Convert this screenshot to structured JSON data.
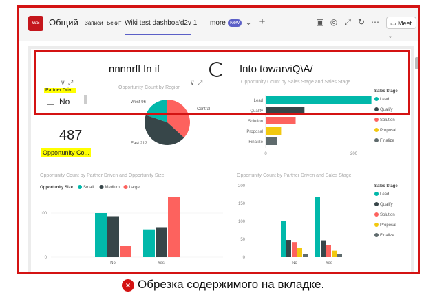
{
  "teams": {
    "app_icon_text": "WS",
    "channel_name": "Общий",
    "tabs": [
      "Записи",
      "Бекит",
      "Wiki test dashboa'd2v 1"
    ],
    "more_label": "more",
    "new_badge": "New",
    "meet_label": "Meet"
  },
  "glitch_text": {
    "left": "nnnnrfl In if",
    "right": "Into towarviQ\\A/"
  },
  "slicer": {
    "title": "Partner Driv...",
    "option_label": "No"
  },
  "card": {
    "value": "487",
    "label": "Opportunity Co..."
  },
  "pie_chart": {
    "title": "Opportunity Count by Region",
    "labels": [
      "West 96",
      "Central",
      "East 212"
    ],
    "colors": [
      "#01b8aa",
      "#fd625e",
      "#374649"
    ]
  },
  "bar_chart": {
    "title": "Opportunity Count by Sales Stage and Sales Stage",
    "legend_title": "Sales Stage",
    "colors": [
      "#01b8aa",
      "#374649",
      "#fd625e",
      "#f2c80f",
      "#5f6b6d"
    ]
  },
  "col_chart_left": {
    "title": "Opportunity Count by Partner Driven and Opportunity Size",
    "legend_title": "Opportunity Size",
    "colors": [
      "#01b8aa",
      "#374649",
      "#fd625e"
    ]
  },
  "col_chart_right": {
    "title": "Opportunity Count by Partner Driven and Sales Stage",
    "legend_title": "Sales Stage",
    "colors": [
      "#01b8aa",
      "#374649",
      "#fd625e",
      "#f2c80f",
      "#5f6b6d"
    ]
  },
  "chart_data": [
    {
      "type": "pie",
      "title": "Opportunity Count by Region",
      "categories": [
        "West",
        "Central",
        "East"
      ],
      "values": [
        96,
        179,
        212
      ]
    },
    {
      "type": "bar",
      "title": "Opportunity Count by Sales Stage and Sales Stage",
      "categories": [
        "Lead",
        "Qualify",
        "Solution",
        "Proposal",
        "Finalize"
      ],
      "values": [
        240,
        88,
        68,
        35,
        25
      ],
      "xlim": [
        0,
        250
      ],
      "x_ticks": [
        "0",
        "200"
      ],
      "legend": [
        "Lead",
        "Qualify",
        "Solution",
        "Proposal",
        "Finalize"
      ],
      "legend_position": "right"
    },
    {
      "type": "bar",
      "title": "Opportunity Count by Partner Driven and Opportunity Size",
      "categories": [
        "No",
        "Yes"
      ],
      "series": [
        {
          "name": "Small",
          "values": [
            100,
            63
          ]
        },
        {
          "name": "Medium",
          "values": [
            93,
            68
          ]
        },
        {
          "name": "Large",
          "values": [
            25,
            137
          ]
        }
      ],
      "ylim": [
        0,
        150
      ],
      "y_ticks": [
        "0",
        "100"
      ],
      "legend_position": "top-left"
    },
    {
      "type": "bar",
      "title": "Opportunity Count by Partner Driven and Sales Stage",
      "categories": [
        "No",
        "Yes"
      ],
      "series": [
        {
          "name": "Lead",
          "values": [
            100,
            168
          ]
        },
        {
          "name": "Qualify",
          "values": [
            48,
            47
          ]
        },
        {
          "name": "Solution",
          "values": [
            42,
            33
          ]
        },
        {
          "name": "Proposal",
          "values": [
            26,
            18
          ]
        },
        {
          "name": "Finalize",
          "values": [
            8,
            8
          ]
        }
      ],
      "ylim": [
        0,
        200
      ],
      "y_ticks": [
        "0",
        "50",
        "100",
        "150",
        "200"
      ],
      "legend_position": "right"
    }
  ],
  "caption": {
    "text": "Обрезка содержимого на вкладке."
  }
}
